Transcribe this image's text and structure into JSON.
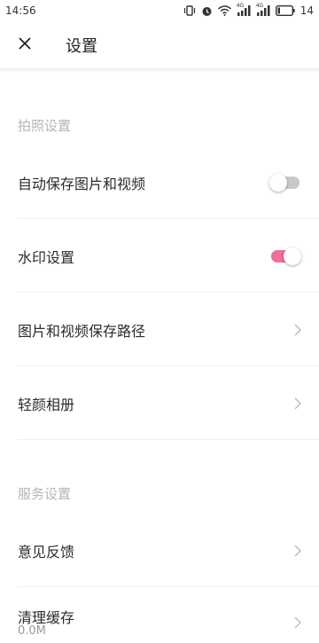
{
  "status_bar": {
    "time": "14:56",
    "network_1": "4G",
    "network_2": "4G",
    "battery_level": "14"
  },
  "header": {
    "title": "设置"
  },
  "sections": {
    "camera": {
      "label": "拍照设置",
      "rows": [
        {
          "label": "自动保存图片和视频",
          "control": "toggle",
          "on": false
        },
        {
          "label": "水印设置",
          "control": "toggle",
          "on": true
        },
        {
          "label": "图片和视频保存路径",
          "control": "chevron"
        },
        {
          "label": "轻颜相册",
          "control": "chevron"
        }
      ]
    },
    "service": {
      "label": "服务设置",
      "rows": [
        {
          "label": "意见反馈",
          "control": "chevron"
        },
        {
          "label": "清理缓存",
          "control": "chevron",
          "sub_value": "0.0M"
        }
      ]
    }
  },
  "colors": {
    "toggle_on": "#f06e97",
    "toggle_off": "#c9c9c9",
    "section_label": "#b5b5b5"
  }
}
